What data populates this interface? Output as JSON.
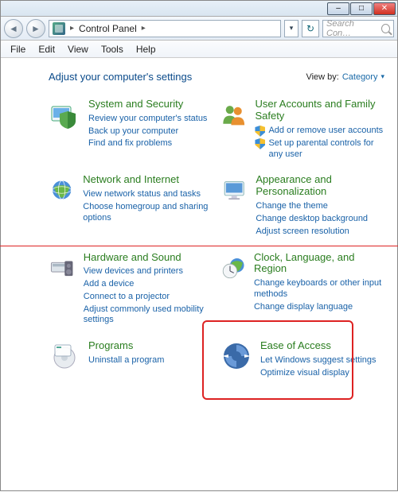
{
  "titlebar": {
    "min": "–",
    "max": "□",
    "close": "✕"
  },
  "nav": {
    "back": "◄",
    "fwd": "►",
    "path": "Control Panel",
    "path_sep": "▸",
    "dropdown": "▾",
    "refresh": "↻"
  },
  "search": {
    "placeholder": "Search Con…"
  },
  "menu": {
    "file": "File",
    "edit": "Edit",
    "view": "View",
    "tools": "Tools",
    "help": "Help"
  },
  "heading": "Adjust your computer's settings",
  "viewby": {
    "label": "View by:",
    "value": "Category",
    "chevron": "▾"
  },
  "cats": {
    "system": {
      "title": "System and Security",
      "links": [
        "Review your computer's status",
        "Back up your computer",
        "Find and fix problems"
      ]
    },
    "users": {
      "title": "User Accounts and Family Safety",
      "links": [
        "Add or remove user accounts",
        "Set up parental controls for any user"
      ]
    },
    "network": {
      "title": "Network and Internet",
      "links": [
        "View network status and tasks",
        "Choose homegroup and sharing options"
      ]
    },
    "appearance": {
      "title": "Appearance and Personalization",
      "links": [
        "Change the theme",
        "Change desktop background",
        "Adjust screen resolution"
      ]
    },
    "hardware": {
      "title": "Hardware and Sound",
      "links": [
        "View devices and printers",
        "Add a device",
        "Connect to a projector",
        "Adjust commonly used mobility settings"
      ]
    },
    "clock": {
      "title": "Clock, Language, and Region",
      "links": [
        "Change keyboards or other input methods",
        "Change display language"
      ]
    },
    "ease": {
      "title": "Ease of Access",
      "links": [
        "Let Windows suggest settings",
        "Optimize visual display"
      ]
    },
    "programs": {
      "title": "Programs",
      "links": [
        "Uninstall a program"
      ]
    }
  }
}
